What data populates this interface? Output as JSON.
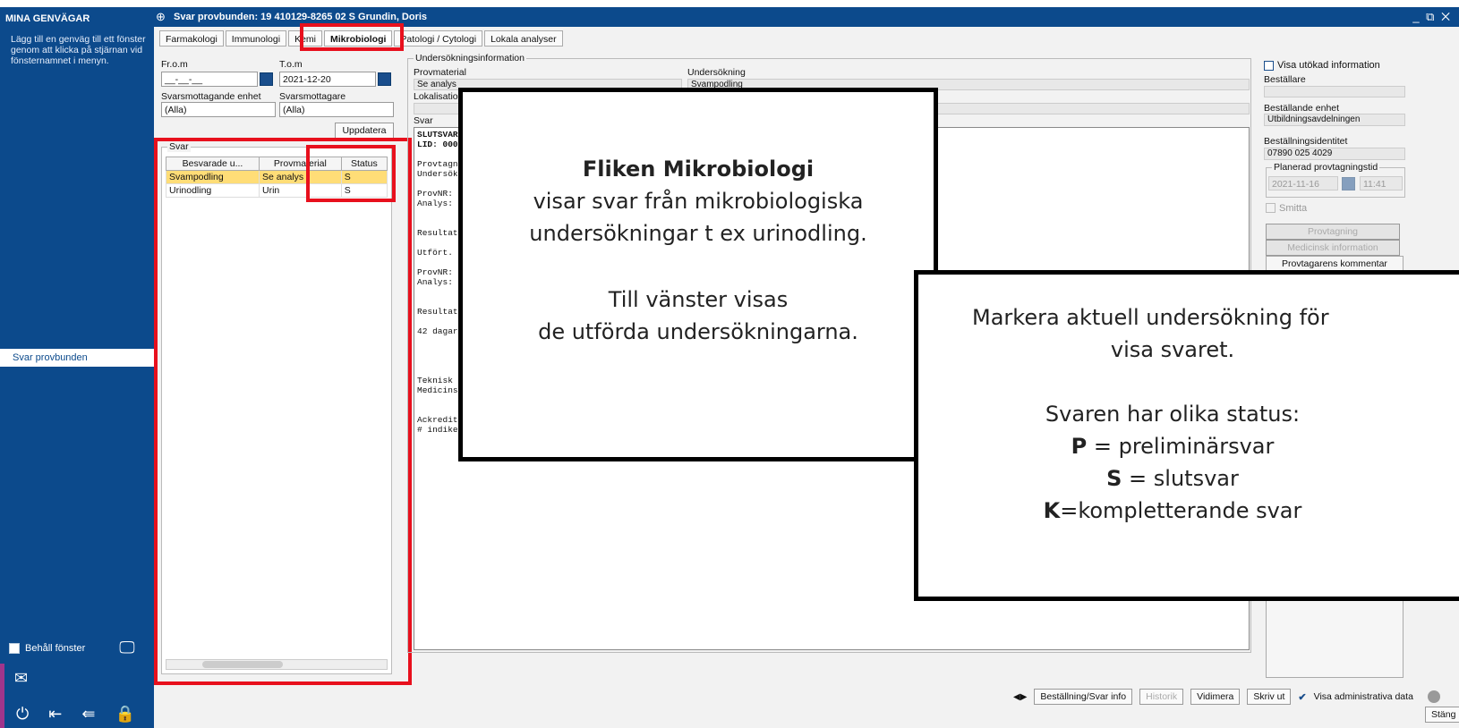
{
  "sidebar": {
    "header": "MINA GENVÄGAR",
    "hint": "Lägg till en genväg till ett fönster genom att klicka på stjärnan vid fönsternamnet i menyn.",
    "item": "Svar provbunden",
    "keep_window": "Behåll fönster"
  },
  "window": {
    "title": "Svar provbunden: 19 410129-8265 02 S Grundin, Doris",
    "controls": "_ ⧉ ✕"
  },
  "tabs": [
    "Farmakologi",
    "Immunologi",
    "Kemi",
    "Mikrobiologi",
    "Patologi / Cytologi",
    "Lokala analyser"
  ],
  "filter": {
    "from_label": "Fr.o.m",
    "from_value": "__-__-__",
    "to_label": "T.o.m",
    "to_value": "2021-12-20",
    "unit_label": "Svarsmottagande enhet",
    "unit_value": "(Alla)",
    "recipient_label": "Svarsmottagare",
    "recipient_value": "(Alla)",
    "update_button": "Uppdatera"
  },
  "answers": {
    "group_title": "Svar",
    "columns": [
      "Besvarade u...",
      "Provmaterial",
      "Status"
    ],
    "rows": [
      [
        "Svampodling",
        "Se analys",
        "S"
      ],
      [
        "Urinodling",
        "Urin",
        "S"
      ]
    ]
  },
  "exam_info": {
    "group_title": "Undersökningsinformation",
    "provmaterial_label": "Provmaterial",
    "provmaterial_value": "Se analys",
    "undersokning_label": "Undersökning",
    "undersokning_value": "Svampodling",
    "lokalisation_label": "Lokalisation",
    "svar_label": "Svar"
  },
  "report_lines": [
    "SLUTSVAR",
    "LID: 00060",
    "",
    "Provtagn:",
    "Undersökn",
    "",
    "ProvNR: 2",
    "Analys: S",
    "",
    "",
    "Resultat:",
    "",
    "Utfört.",
    "",
    "ProvNR: 2",
    "Analys: S",
    "",
    "",
    "Resultat:",
    "",
    "42 dagar",
    "",
    "",
    "",
    "",
    "Teknisk a",
    "Medicinsk",
    "",
    "",
    "Ackrediterat lab. nr 1319 enligt EN/ISO 15189",
    "# indikerar att metoden ej är ackrediterad, men kvalitetssäkrad"
  ],
  "right_panel": {
    "visa_utokad": "Visa utökad information",
    "bestallare_label": "Beställare",
    "bestallande_enhet_label": "Beställande enhet",
    "bestallande_enhet_value": "Utbildningsavdelningen",
    "bestallningsidentitet_label": "Beställningsidentitet",
    "bestallningsidentitet_value": "07890 025 4029",
    "planerad_label": "Planerad provtagningstid",
    "planerad_date": "2021-11-16",
    "planerad_time": "11:41",
    "smitta": "Smitta",
    "provtagning_button": "Provtagning",
    "medicinsk_button": "Medicinsk information",
    "kommentar": "Provtagarens kommentar"
  },
  "bottom": {
    "arrows": "◀▶",
    "bestallning": "Beställning/Svar info",
    "historik": "Historik",
    "vidimera": "Vidimera",
    "skriv_ut": "Skriv ut",
    "visa_admin": "Visa administrativa data",
    "stang": "Stäng"
  },
  "callout1": {
    "heading": "Fliken Mikrobiologi",
    "line1": "visar svar från mikrobiologiska",
    "line2": "undersökningar t ex urinodling.",
    "line3": "Till vänster visas",
    "line4": "de utförda undersökningarna."
  },
  "callout2": {
    "line1": "Markera aktuell undersökning för",
    "line2": "visa svaret.",
    "line3": "Svaren har olika status:",
    "p_key": "P",
    "p_text": " = preliminärsvar",
    "s_key": "S",
    "s_text": " = slutsvar",
    "k_key": "K",
    "k_text": "=kompletterande svar"
  }
}
